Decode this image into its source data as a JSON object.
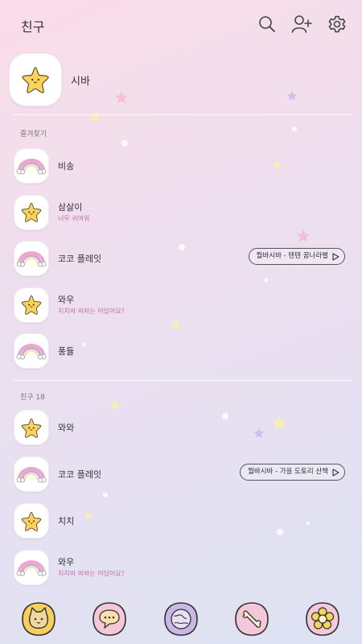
{
  "header": {
    "title": "친구",
    "icons": [
      "search-icon",
      "add-friend-icon",
      "settings-icon"
    ]
  },
  "profile": {
    "name": "시바",
    "avatar": "star"
  },
  "favorites": {
    "label": "즐겨찾기",
    "items": [
      {
        "name": "비송",
        "status": "",
        "avatar": "rainbow",
        "music": ""
      },
      {
        "name": "삼살이",
        "status": "너무 귀여워",
        "avatar": "star",
        "music": ""
      },
      {
        "name": "코코 플레잇",
        "status": "",
        "avatar": "rainbow",
        "music": "뭘바시바 - 텐텐 꿈나라별"
      },
      {
        "name": "와우",
        "status": "치치와 와와는 어딨어요?",
        "avatar": "star",
        "music": ""
      },
      {
        "name": "퐁듈",
        "status": "",
        "avatar": "rainbow",
        "music": ""
      }
    ]
  },
  "friends": {
    "label": "친구 18",
    "items": [
      {
        "name": "와와",
        "status": "",
        "avatar": "star",
        "music": ""
      },
      {
        "name": "코코 플레잇",
        "status": "",
        "avatar": "rainbow",
        "music": "뭘바시바 - 가을 도토리 산책"
      },
      {
        "name": "치치",
        "status": "",
        "avatar": "star",
        "music": ""
      },
      {
        "name": "와우",
        "status": "치치와 와와는 어딨어요?",
        "avatar": "rainbow",
        "music": ""
      }
    ]
  },
  "bottom_nav": [
    "friends-tab-icon",
    "chat-tab-icon",
    "openchat-tab-icon",
    "shopping-tab-icon",
    "more-tab-icon"
  ],
  "colors": {
    "status_pink": "#c06fa8",
    "star_yellow": "#f9d35a",
    "rainbow_pink": "#f2a6c6",
    "rainbow_purple": "#c7a8e6",
    "nav_yellow": "#f7cf5b",
    "nav_pink": "#f4c7d9",
    "nav_purple": "#c9b8e6"
  }
}
